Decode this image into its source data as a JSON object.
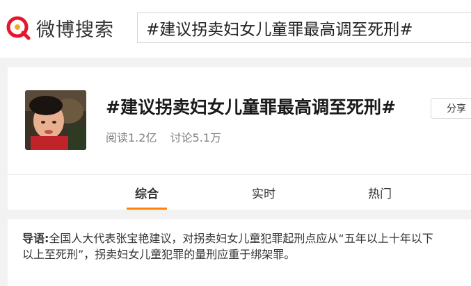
{
  "header": {
    "logo_text": "微博搜索",
    "search_value": "#建议拐卖妇女儿童罪最高调至死刑#"
  },
  "topic": {
    "title": "#建议拐卖妇女儿童罪最高调至死刑#",
    "reads": "阅读1.2亿",
    "discussions": "讨论5.1万",
    "share_label": "分享"
  },
  "tabs": [
    {
      "label": "综合",
      "active": true
    },
    {
      "label": "实时",
      "active": false
    },
    {
      "label": "热门",
      "active": false
    }
  ],
  "intro": {
    "label": "导语:",
    "line1": "全国人大代表张宝艳建议，对拐卖妇女儿童犯罪起刑点应从“五年以上十年以下",
    "line2": "以上至死刑”，拐卖妇女儿童犯罪的量刑应重于绑架罪。"
  },
  "colors": {
    "accent": "#ff8200",
    "logo": "#e6162d"
  }
}
